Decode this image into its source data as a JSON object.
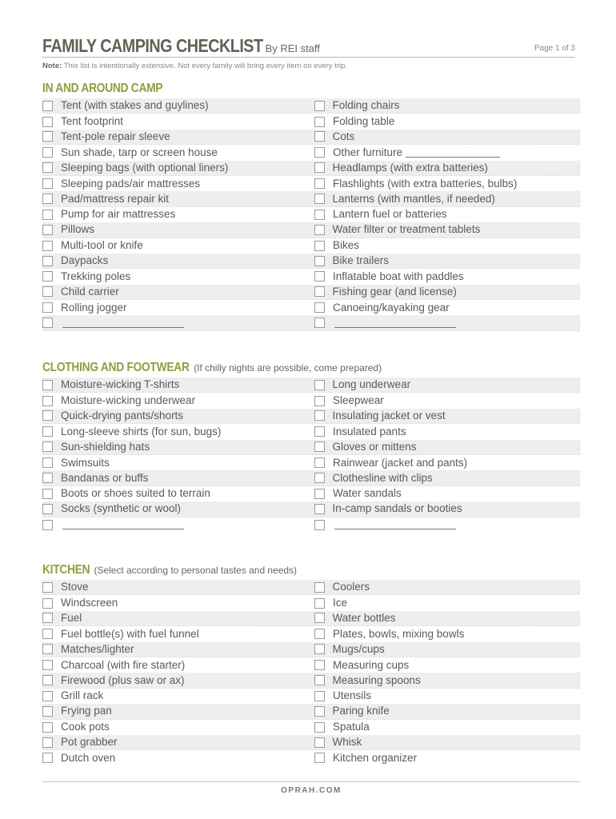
{
  "header": {
    "title": "FAMILY CAMPING CHECKLIST",
    "byline": "By REI staff",
    "page": "Page 1 of 3"
  },
  "note": {
    "label": "Note:",
    "text": " This list is intentionally extensive. Not every family will bring every item on every trip."
  },
  "sections": [
    {
      "title": "IN AND AROUND CAMP",
      "subtitle": "",
      "left": [
        "Tent (with stakes and guylines)",
        "Tent footprint",
        "Tent-pole repair sleeve",
        "Sun shade, tarp or screen house",
        "Sleeping bags (with optional liners)",
        "Sleeping pads/air mattresses",
        "Pad/mattress repair kit",
        "Pump for air mattresses",
        "Pillows",
        "Multi-tool or knife",
        "Daypacks",
        "Trekking poles",
        "Child carrier",
        "Rolling jogger",
        ""
      ],
      "right": [
        "Folding chairs",
        "Folding table",
        "Cots",
        "Other furniture",
        "Headlamps (with extra batteries)",
        "Flashlights (with extra batteries, bulbs)",
        "Lanterns (with mantles, if needed)",
        "Lantern fuel or batteries",
        "Water filter or treatment tablets",
        "Bikes",
        "Bike trailers",
        "Inflatable boat with paddles",
        "Fishing gear (and license)",
        "Canoeing/kayaking gear",
        ""
      ]
    },
    {
      "title": "CLOTHING AND FOOTWEAR",
      "subtitle": "(If chilly nights are possible, come prepared)",
      "left": [
        "Moisture-wicking T-shirts",
        "Moisture-wicking underwear",
        "Quick-drying pants/shorts",
        "Long-sleeve shirts (for sun, bugs)",
        "Sun-shielding hats",
        "Swimsuits",
        "Bandanas or buffs",
        "Boots or shoes suited to terrain",
        "Socks (synthetic or wool)",
        ""
      ],
      "right": [
        "Long underwear",
        "Sleepwear",
        "Insulating jacket or vest",
        "Insulated pants",
        "Gloves or mittens",
        "Rainwear (jacket and pants)",
        "Clothesline with clips",
        "Water sandals",
        "In-camp sandals or booties",
        ""
      ]
    },
    {
      "title": "KITCHEN",
      "subtitle": "(Select according to personal tastes and needs)",
      "left": [
        "Stove",
        "Windscreen",
        "Fuel",
        "Fuel bottle(s) with fuel funnel",
        "Matches/lighter",
        "Charcoal (with fire starter)",
        "Firewood (plus saw or ax)",
        "Grill rack",
        "Frying pan",
        "Cook pots",
        "Pot grabber",
        "Dutch oven"
      ],
      "right": [
        "Coolers",
        "Ice",
        "Water bottles",
        "Plates, bowls, mixing bowls",
        "Mugs/cups",
        "Measuring cups",
        "Measuring spoons",
        "Utensils",
        "Paring knife",
        "Spatula",
        "Whisk",
        "Kitchen organizer"
      ]
    }
  ],
  "footer": {
    "text": "OPRAH.COM"
  },
  "colors": {
    "title": "#5f6455",
    "section_accent": "#8d9f3d",
    "row_shade": "#eeeeef"
  }
}
